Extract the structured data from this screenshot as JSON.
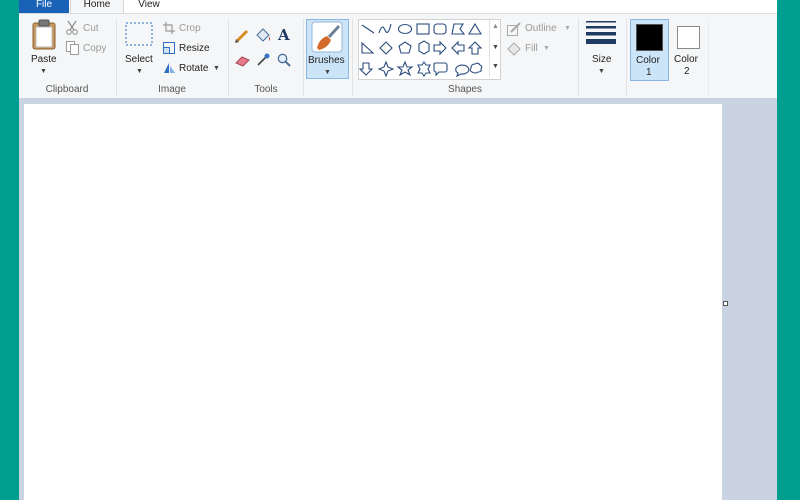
{
  "tabs": {
    "file": "File",
    "home": "Home",
    "view": "View"
  },
  "clipboard": {
    "paste": "Paste",
    "cut": "Cut",
    "copy": "Copy",
    "label": "Clipboard"
  },
  "image": {
    "select": "Select",
    "crop": "Crop",
    "resize": "Resize",
    "rotate": "Rotate",
    "label": "Image"
  },
  "tools": {
    "label": "Tools",
    "text_glyph": "A"
  },
  "brushes": {
    "label": "Brushes"
  },
  "shapes": {
    "outline": "Outline",
    "fill": "Fill",
    "label": "Shapes"
  },
  "size": {
    "label": "Size"
  },
  "colors": {
    "color1": "Color\n1",
    "color1_a": "Color",
    "color1_b": "1",
    "color2_a": "Color",
    "color2_b": "2",
    "color1_value": "#000000",
    "color2_value": "#ffffff"
  },
  "theme": {
    "accent": "#1a62b8",
    "background": "#009e8f",
    "canvas_surround": "#c9d3e2"
  }
}
